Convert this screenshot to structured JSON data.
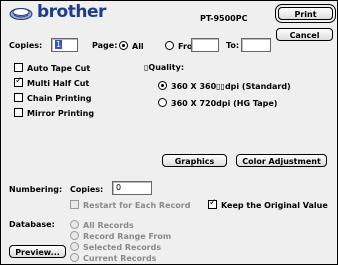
{
  "header": {
    "brand": "brother",
    "model": "PT-9500PC",
    "print_label": "Print",
    "cancel_label": "Cancel"
  },
  "copies": {
    "label": "Copies:",
    "value": "1"
  },
  "page": {
    "label": "Page:",
    "all_label": "All",
    "from_label": "From:",
    "from_value": "",
    "to_label": "To:",
    "to_value": ""
  },
  "options": [
    {
      "label": "Auto Tape Cut",
      "checked": false
    },
    {
      "label": "Multi Half Cut",
      "checked": true
    },
    {
      "label": "Chain Printing",
      "checked": false
    },
    {
      "label": "Mirror Printing",
      "checked": false
    }
  ],
  "quality": {
    "label": "▯Quality:",
    "options": [
      {
        "label": "360 X 360▯▯dpi (Standard)",
        "selected": true
      },
      {
        "label": "360 X 720dpi (HG Tape)",
        "selected": false
      }
    ]
  },
  "buttons": {
    "graphics_label": "Graphics",
    "color_adjustment_label": "Color Adjustment",
    "preview_label": "Preview..."
  },
  "numbering": {
    "label": "Numbering:",
    "copies_label": "Copies:",
    "copies_value": "0",
    "restart_label": "Restart for Each Record",
    "restart_checked": false,
    "keep_label": "Keep the Original Value",
    "keep_checked": true
  },
  "database": {
    "label": "Database:",
    "options": [
      {
        "label": "All Records",
        "selected": false
      },
      {
        "label": "Record Range From",
        "selected": false
      },
      {
        "label": "Selected Records",
        "selected": false
      },
      {
        "label": "Current Records",
        "selected": false
      }
    ]
  },
  "colors": {
    "brand": "#1e3a8a",
    "disabled_text": "#8a8a8a",
    "dialog_bg": "#efefef"
  }
}
